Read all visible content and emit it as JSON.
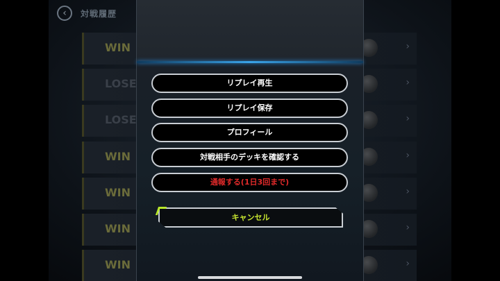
{
  "header": {
    "title": "対戦履歴"
  },
  "history": [
    {
      "result": "WIN"
    },
    {
      "result": "LOSE"
    },
    {
      "result": "LOSE"
    },
    {
      "result": "WIN"
    },
    {
      "result": "WIN"
    },
    {
      "result": "WIN"
    },
    {
      "result": "WIN"
    }
  ],
  "menu": {
    "replay_play": "リプレイ再生",
    "replay_save": "リプレイ保存",
    "profile": "プロフィール",
    "check_deck": "対戦相手のデッキを確認する",
    "report": "通報する(1日3回まで)",
    "cancel": "キャンセル"
  },
  "colors": {
    "accent": "#c8e630",
    "danger": "#e02a2a",
    "divider": "#3aa3e8"
  }
}
